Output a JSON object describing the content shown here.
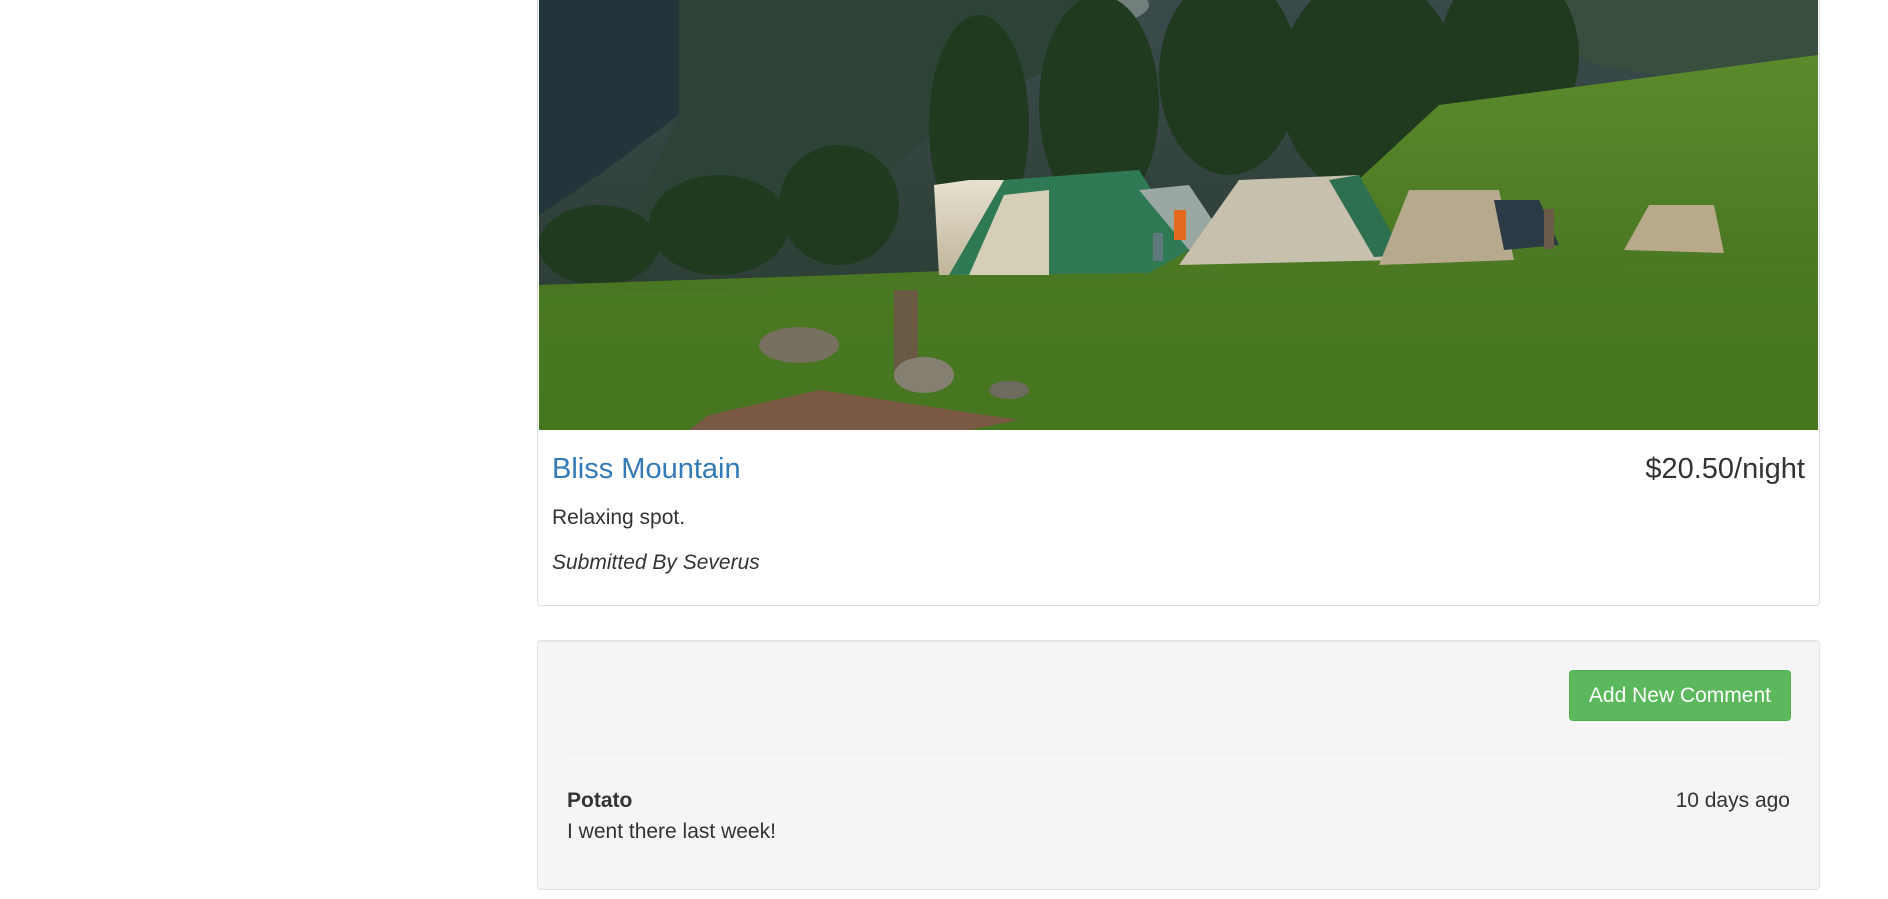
{
  "campground": {
    "name": "Bliss Mountain",
    "price": "$20.50/night",
    "description": "Relaxing spot.",
    "submitted_by": "Submitted By Severus"
  },
  "comments_panel": {
    "add_button_label": "Add New Comment",
    "comments": [
      {
        "author": "Potato",
        "time": "10 days ago",
        "text": "I went there last week!"
      }
    ]
  },
  "colors": {
    "link": "#337ab7",
    "success_button": "#5cb85c",
    "well_background": "#f5f5f5"
  }
}
